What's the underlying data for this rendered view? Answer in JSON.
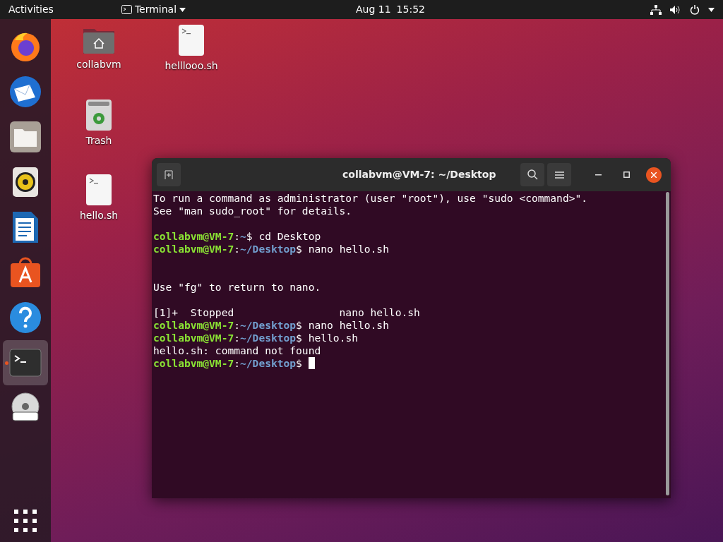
{
  "top_bar": {
    "activities": "Activities",
    "app_menu": "Terminal",
    "date": "Aug 11",
    "time": "15:52"
  },
  "dock": [
    {
      "kind": "browser",
      "selected": false
    },
    {
      "kind": "mail",
      "selected": false
    },
    {
      "kind": "files",
      "selected": false
    },
    {
      "kind": "music",
      "selected": false
    },
    {
      "kind": "writer",
      "selected": false
    },
    {
      "kind": "store",
      "selected": false
    },
    {
      "kind": "help",
      "selected": false
    },
    {
      "kind": "terminal",
      "selected": true
    },
    {
      "kind": "disc",
      "selected": false
    }
  ],
  "desktop_icons": [
    {
      "kind": "home",
      "label": "collabvm"
    },
    {
      "kind": "script",
      "label": "helllooo.sh"
    },
    {
      "kind": "trash",
      "label": "Trash"
    },
    {
      "kind": "script",
      "label": "hello.sh"
    }
  ],
  "terminal": {
    "title": "collabvm@VM-7: ~/Desktop",
    "lines": [
      {
        "kind": "output",
        "text": "To run a command as administrator (user \"root\"), use \"sudo <command>\"."
      },
      {
        "kind": "output",
        "text": "See \"man sudo_root\" for details."
      },
      {
        "kind": "blank"
      },
      {
        "kind": "prompt",
        "user": "collabvm@VM-7",
        "sep": ":",
        "path": "~",
        "symbol": "$",
        "command": "cd Desktop"
      },
      {
        "kind": "prompt",
        "user": "collabvm@VM-7",
        "sep": ":",
        "path": "~/Desktop",
        "symbol": "$",
        "command": "nano hello.sh"
      },
      {
        "kind": "blank"
      },
      {
        "kind": "blank"
      },
      {
        "kind": "output",
        "text": "Use \"fg\" to return to nano."
      },
      {
        "kind": "blank"
      },
      {
        "kind": "output",
        "text": "[1]+  Stopped                 nano hello.sh"
      },
      {
        "kind": "prompt",
        "user": "collabvm@VM-7",
        "sep": ":",
        "path": "~/Desktop",
        "symbol": "$",
        "command": "nano hello.sh"
      },
      {
        "kind": "prompt",
        "user": "collabvm@VM-7",
        "sep": ":",
        "path": "~/Desktop",
        "symbol": "$",
        "command": "hello.sh"
      },
      {
        "kind": "output",
        "text": "hello.sh: command not found"
      },
      {
        "kind": "prompt",
        "user": "collabvm@VM-7",
        "sep": ":",
        "path": "~/Desktop",
        "symbol": "$",
        "cursor": true
      }
    ]
  }
}
